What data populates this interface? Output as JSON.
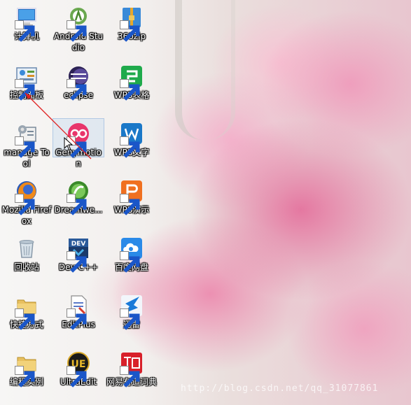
{
  "desktop": {
    "icons": [
      {
        "label": "计算机",
        "icon": "computer-icon"
      },
      {
        "label": "Android Studio",
        "icon": "android-studio-icon"
      },
      {
        "label": "360zip",
        "icon": "360zip-icon"
      },
      {
        "label": "控制面板",
        "icon": "control-panel-icon"
      },
      {
        "label": "eclipse",
        "icon": "eclipse-icon"
      },
      {
        "label": "WPS表格",
        "icon": "wps-spreadsheet-icon"
      },
      {
        "label": "manage Tool",
        "icon": "manage-tool-icon"
      },
      {
        "label": "Genymotion",
        "icon": "genymotion-icon"
      },
      {
        "label": "WPS文字",
        "icon": "wps-writer-icon"
      },
      {
        "label": "Mozilla Firefox",
        "icon": "firefox-icon"
      },
      {
        "label": "Dreamwe...",
        "icon": "dreamweaver-icon"
      },
      {
        "label": "WPS演示",
        "icon": "wps-presentation-icon"
      },
      {
        "label": "回收站",
        "icon": "recycle-bin-icon"
      },
      {
        "label": "Dev-C++",
        "icon": "dev-cpp-icon"
      },
      {
        "label": "百度网盘",
        "icon": "baidu-netdisk-icon"
      },
      {
        "label": "快捷方式",
        "icon": "folder-icon"
      },
      {
        "label": "EditPlus",
        "icon": "editplus-icon"
      },
      {
        "label": "迅雷",
        "icon": "xunlei-icon"
      },
      {
        "label": "编程实例",
        "icon": "folder-icon"
      },
      {
        "label": "UltraEdit",
        "icon": "ultraedit-icon"
      },
      {
        "label": "网易有道词典",
        "icon": "youdao-dict-icon"
      }
    ],
    "selected_label": "Genymotion"
  },
  "watermark": "http://blog.csdn.net/qq_31077861",
  "colors": {
    "wps_green": "#1faa4b",
    "wps_blue": "#1a78c8",
    "wps_orange": "#f07020",
    "genymotion_pink": "#e8356b",
    "annotation_red": "#e02020",
    "youdao_red": "#d8202a"
  }
}
